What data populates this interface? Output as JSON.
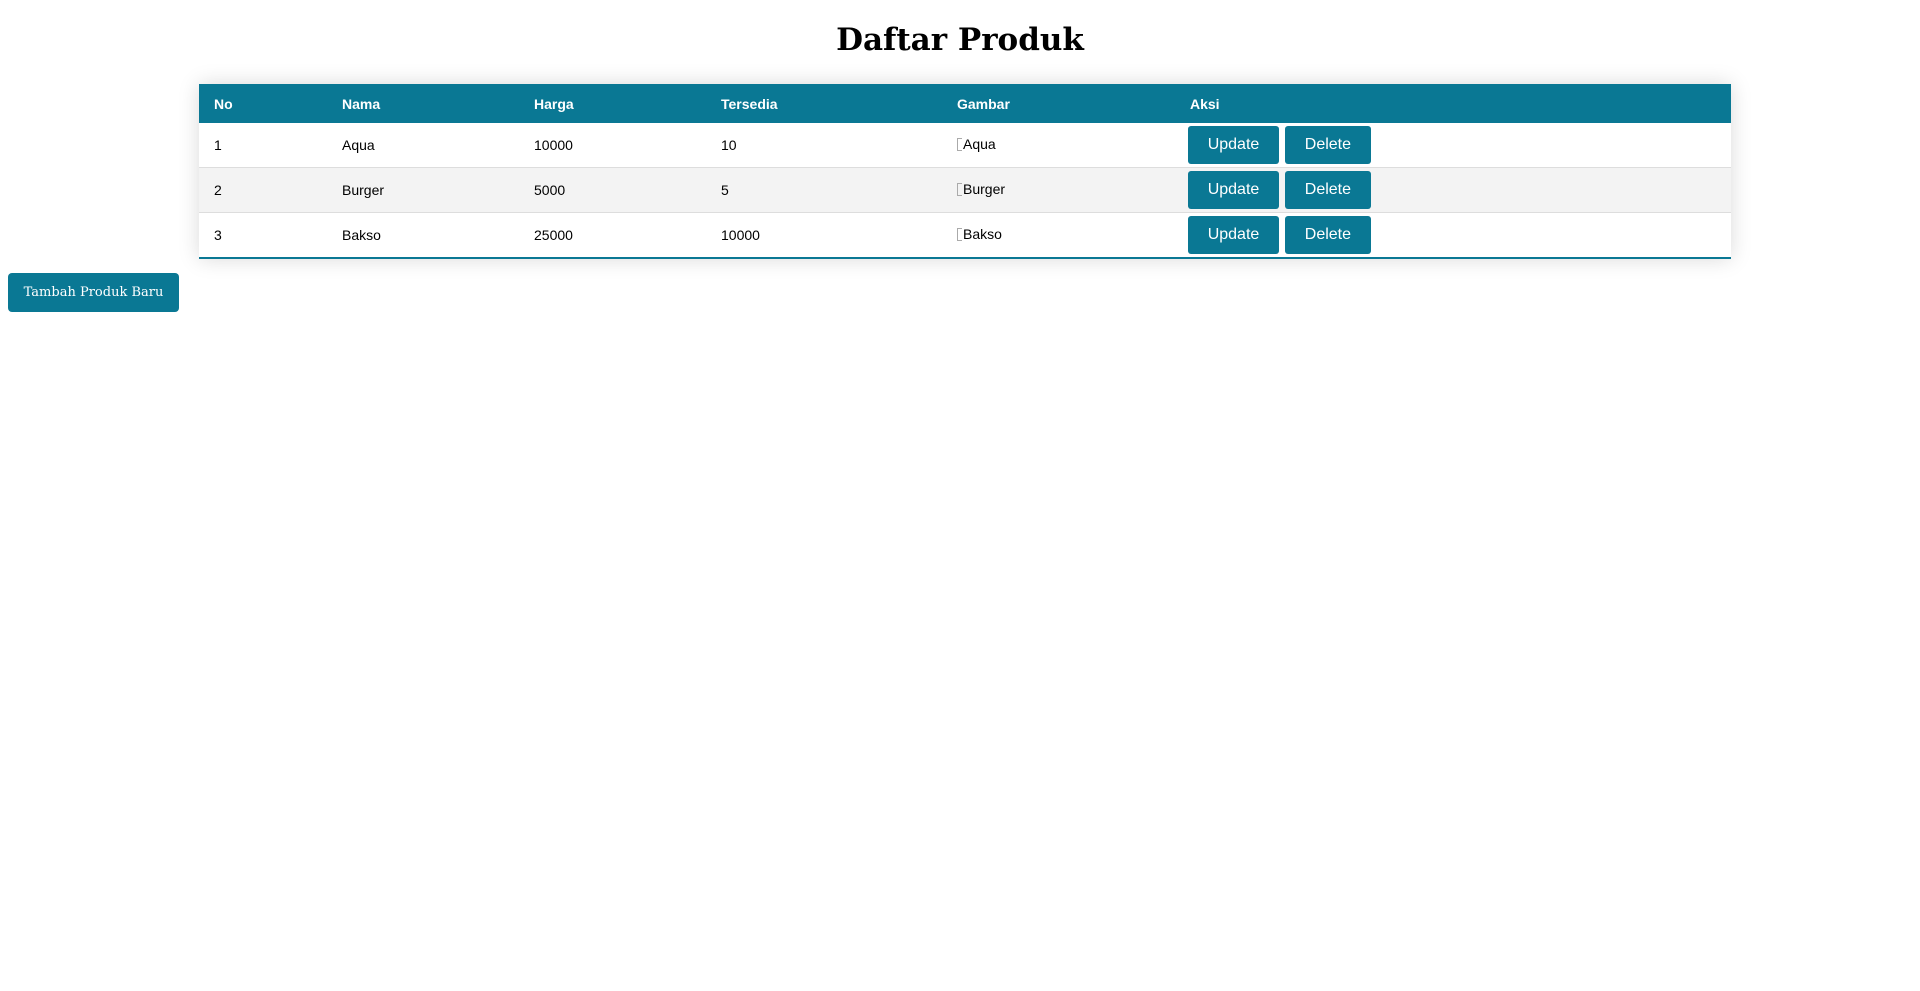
{
  "page": {
    "title": "Daftar Produk"
  },
  "table": {
    "headers": [
      "No",
      "Nama",
      "Harga",
      "Tersedia",
      "Gambar",
      "Aksi"
    ],
    "rows": [
      {
        "no": "1",
        "nama": "Aqua",
        "harga": "10000",
        "tersedia": "10",
        "gambar_alt": "Aqua"
      },
      {
        "no": "2",
        "nama": "Burger",
        "harga": "5000",
        "tersedia": "5",
        "gambar_alt": "Burger"
      },
      {
        "no": "3",
        "nama": "Bakso",
        "harga": "25000",
        "tersedia": "10000",
        "gambar_alt": "Bakso"
      }
    ],
    "update_label": "Update",
    "delete_label": "Delete"
  },
  "actions": {
    "add_label": "Tambah Produk Baru"
  },
  "colors": {
    "accent": "#0a7894",
    "row_alt": "#f3f3f3"
  },
  "icons": {
    "product_image": "broken-image-icon"
  }
}
